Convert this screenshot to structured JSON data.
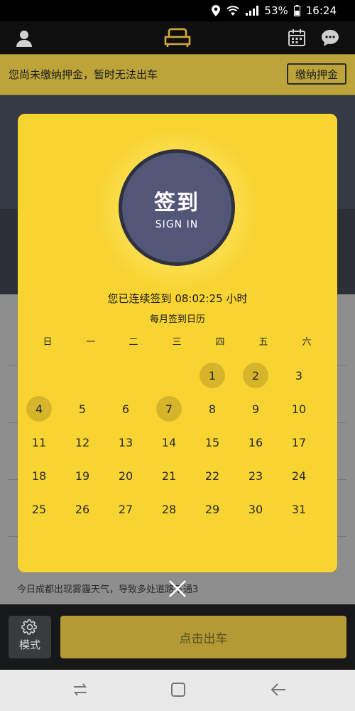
{
  "status": {
    "battery": "53%",
    "time": "16:24"
  },
  "notice": {
    "text": "您尚未缴纳押金，暂时无法出车",
    "button": "缴纳押金"
  },
  "modal": {
    "sign_label": "签到",
    "sign_label_en": "SIGN IN",
    "streak": "您已连续签到 08:02:25 小时",
    "calendar_title": "每月签到日历",
    "weekdays": [
      "日",
      "一",
      "二",
      "三",
      "四",
      "五",
      "六"
    ],
    "days": [
      "1",
      "2",
      "3",
      "4",
      "5",
      "6",
      "7",
      "8",
      "9",
      "10",
      "11",
      "12",
      "13",
      "14",
      "15",
      "16",
      "17",
      "18",
      "19",
      "20",
      "21",
      "22",
      "23",
      "24",
      "25",
      "26",
      "27",
      "28",
      "29",
      "30",
      "31"
    ],
    "signed_days": [
      1,
      2,
      4,
      7
    ]
  },
  "news": "今日成都出现雾霾天气，导致多处道路不通3",
  "bottom": {
    "mode_label": "模式",
    "depart_label": "点击出车"
  },
  "colors": {
    "accent": "#f7d432",
    "button_bg": "#b39a35",
    "signin": "#525778"
  }
}
